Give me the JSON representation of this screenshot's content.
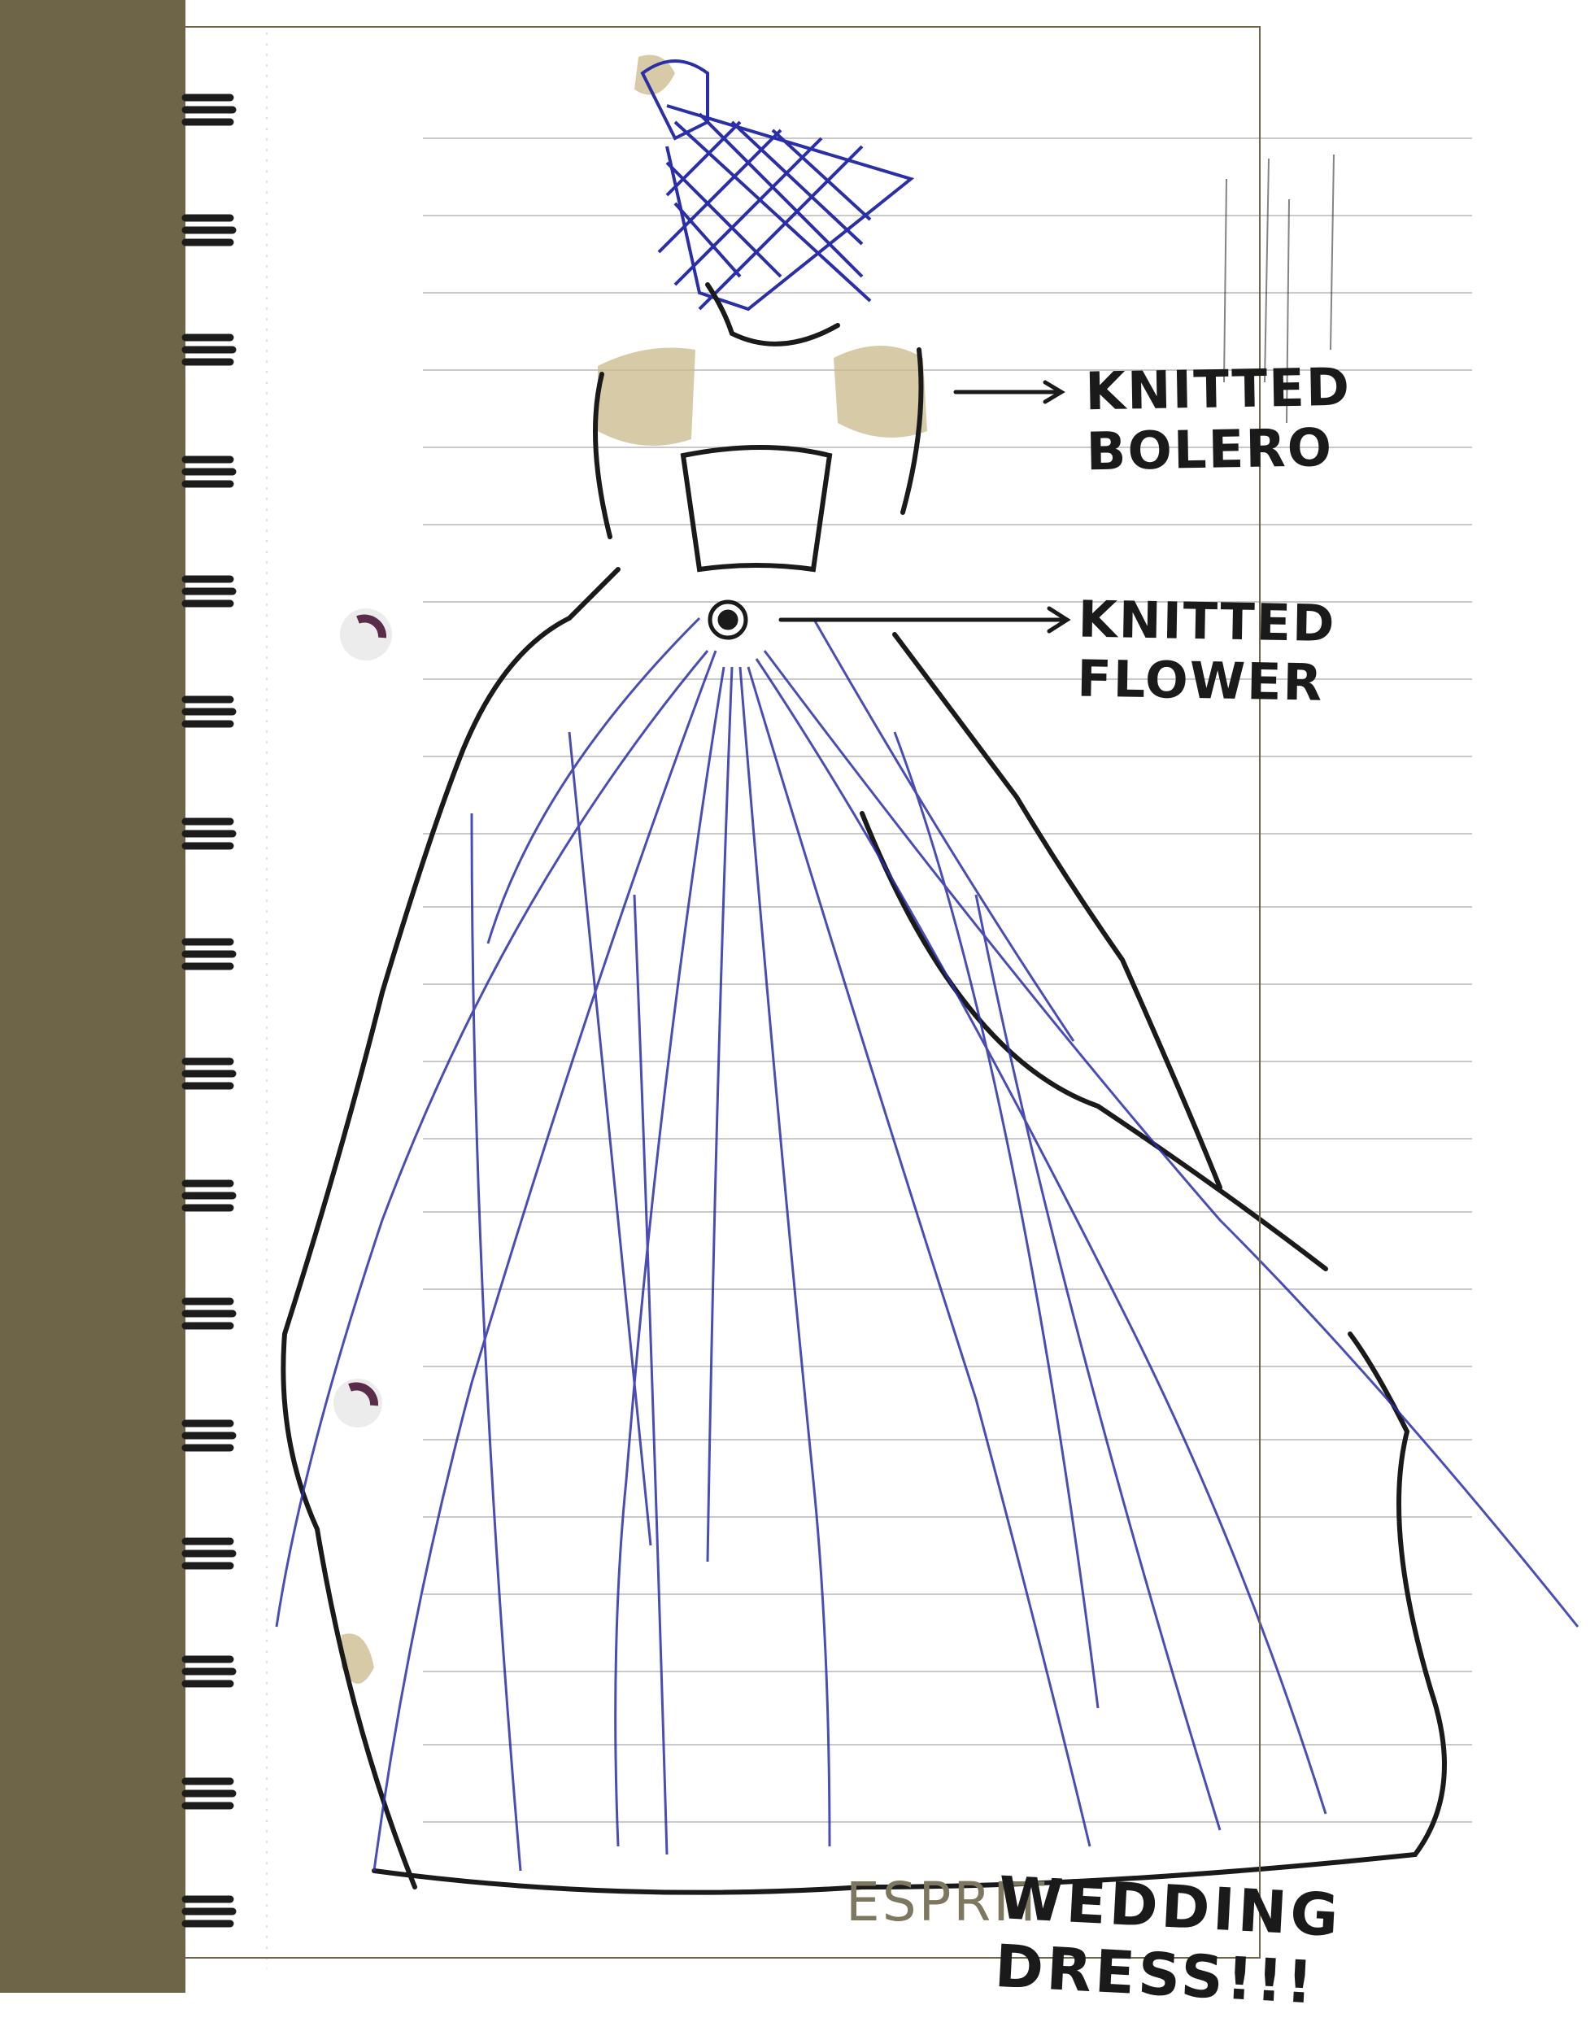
{
  "annotations": {
    "bolero_label": "KNITTED BOLERO",
    "flower_label": "KNITTED FLOWER"
  },
  "footer": {
    "brand": "ESPRIT",
    "caption": "WEDDING DRESS!!!"
  },
  "colors": {
    "cover": "#6e6549",
    "ruled_line": "#c9c9c9",
    "blue_ink": "#2a2fa8",
    "black_ink": "#1a1a1a",
    "highlight": "#c9b98a"
  }
}
